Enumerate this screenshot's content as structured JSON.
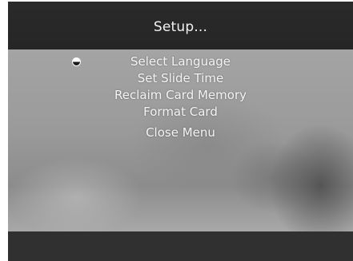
{
  "header": {
    "title": "Setup..."
  },
  "menu": {
    "items": [
      {
        "label": "Select Language",
        "selected": true
      },
      {
        "label": "Set Slide Time",
        "selected": false
      },
      {
        "label": "Reclaim Card Memory",
        "selected": false
      },
      {
        "label": "Format Card",
        "selected": false
      },
      {
        "label": "Close Menu",
        "selected": false
      }
    ],
    "selector_icon": "selection-dot-icon"
  }
}
